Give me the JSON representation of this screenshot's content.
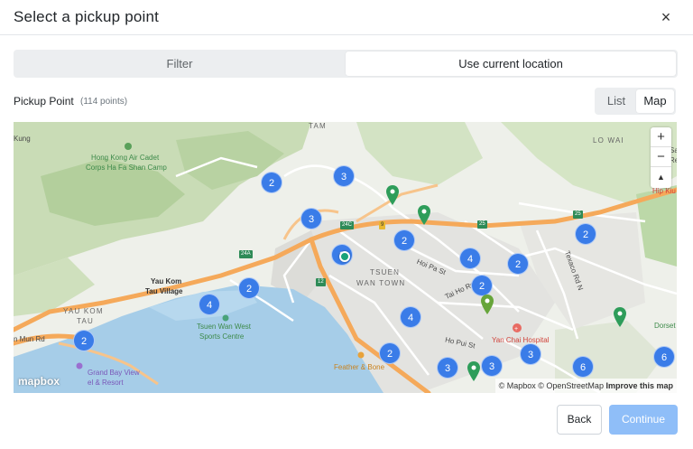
{
  "header": {
    "title": "Select a pickup point",
    "close_glyph": "×",
    "close_icon": "close-icon"
  },
  "segmented": {
    "filter_label": "Filter",
    "location_label": "Use current location",
    "selected": "Use current location"
  },
  "pickup": {
    "label": "Pickup Point",
    "count": "(114 points)"
  },
  "view_toggle": {
    "list_label": "List",
    "map_label": "Map",
    "selected": "Map"
  },
  "map": {
    "zoom_in": "+",
    "zoom_out": "−",
    "compass": "▲",
    "logo": "mapbox",
    "attribution": "© Mapbox © OpenStreetMap",
    "improve": "Improve this map",
    "clusters": [
      "2",
      "3",
      "3",
      "2",
      "2",
      "4",
      "2",
      "2",
      "4",
      "2",
      "4",
      "2",
      "3",
      "3",
      "3",
      "2",
      "6"
    ],
    "labels": {
      "tam": "TAM",
      "kung": "Kung",
      "lo_wai": "LO WAI",
      "sa": "Sa",
      "re": "Re",
      "hip_kiu": "Hip Kiu",
      "cadet_1": "Hong Kong Air Cadet",
      "cadet_2": "Corps Ha Fa Shan Camp",
      "yau_kom_1": "Yau Kom",
      "yau_kom_2": "Tau Village",
      "yau_kom_tau_1": "YAU KOM",
      "yau_kom_tau_2": "TAU",
      "tsuen_wan_1": "TSUEN",
      "tsuen_wan_2": "WAN TOWN",
      "hoi_pa": "Hoi Pa St",
      "tai_ho": "Tai Ho Rd",
      "texaco": "Texaco Rd N",
      "ho_pui": "Ho Pui St",
      "sports_1": "Tsuen Wan West",
      "sports_2": "Sports Centre",
      "hospital": "Yan Chai Hospital",
      "feather": "Feather & Bone",
      "grand_bay_1": "Grand Bay View",
      "grand_bay_2": "el & Resort",
      "dorset": "Dorset",
      "men_rd": "n Mun Rd"
    },
    "shields": {
      "s24c": "24C",
      "s9": "9",
      "s25a": "25",
      "s25b": "25",
      "s24a": "24A",
      "s12": "12"
    }
  },
  "footer": {
    "back_label": "Back",
    "continue_label": "Continue"
  },
  "colors": {
    "accent": "#3a7ce8",
    "continue_disabled": "#8fbef8",
    "pin_green": "#2e9d5a",
    "pin_olive": "#67a53a",
    "highway": "#f5a95a"
  }
}
